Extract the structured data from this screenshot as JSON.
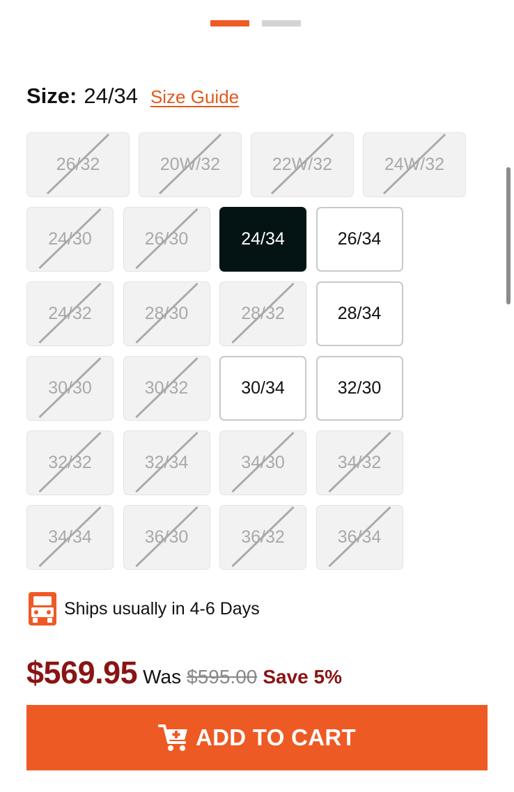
{
  "carousel": {
    "pages": 2,
    "active_page": 1
  },
  "size": {
    "label": "Size:",
    "selected_value": "24/34",
    "guide_label": "Size Guide"
  },
  "sizes": [
    {
      "label": "26/32",
      "state": "unavailable"
    },
    {
      "label": "20W/32",
      "state": "unavailable"
    },
    {
      "label": "22W/32",
      "state": "unavailable"
    },
    {
      "label": "24W/32",
      "state": "unavailable"
    },
    {
      "label": "24/30",
      "state": "unavailable"
    },
    {
      "label": "26/30",
      "state": "unavailable"
    },
    {
      "label": "24/34",
      "state": "selected"
    },
    {
      "label": "26/34",
      "state": "available"
    },
    {
      "label": "24/32",
      "state": "unavailable"
    },
    {
      "label": "28/30",
      "state": "unavailable"
    },
    {
      "label": "28/32",
      "state": "unavailable"
    },
    {
      "label": "28/34",
      "state": "available"
    },
    {
      "label": "30/30",
      "state": "unavailable"
    },
    {
      "label": "30/32",
      "state": "unavailable"
    },
    {
      "label": "30/34",
      "state": "available"
    },
    {
      "label": "32/30",
      "state": "available"
    },
    {
      "label": "32/32",
      "state": "unavailable"
    },
    {
      "label": "32/34",
      "state": "unavailable"
    },
    {
      "label": "34/30",
      "state": "unavailable"
    },
    {
      "label": "34/32",
      "state": "unavailable"
    },
    {
      "label": "34/34",
      "state": "unavailable"
    },
    {
      "label": "36/30",
      "state": "unavailable"
    },
    {
      "label": "36/32",
      "state": "unavailable"
    },
    {
      "label": "36/34",
      "state": "unavailable"
    }
  ],
  "shipping": {
    "icon": "truck-icon",
    "text": "Ships usually in 4-6 Days"
  },
  "pricing": {
    "price": "$569.95",
    "was_label": "Was",
    "original_price": "$595.00",
    "save_label": "Save 5%"
  },
  "cart": {
    "icon": "add-to-cart-icon",
    "label": "ADD TO CART"
  },
  "colors": {
    "accent": "#ee5a24",
    "sale_red": "#8a1414",
    "selected_bg": "#041414"
  }
}
